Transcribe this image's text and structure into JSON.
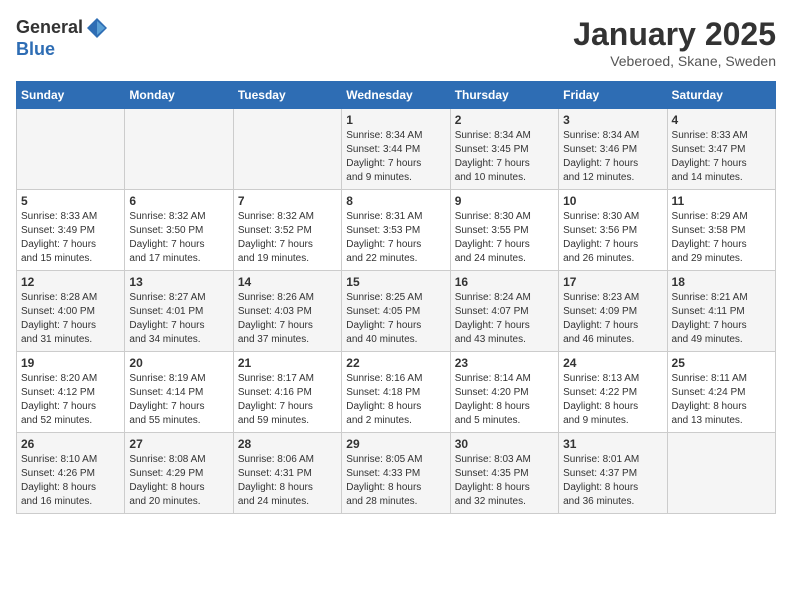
{
  "logo": {
    "general": "General",
    "blue": "Blue"
  },
  "title": "January 2025",
  "location": "Veberoed, Skane, Sweden",
  "days_of_week": [
    "Sunday",
    "Monday",
    "Tuesday",
    "Wednesday",
    "Thursday",
    "Friday",
    "Saturday"
  ],
  "weeks": [
    [
      {
        "day": "",
        "info": ""
      },
      {
        "day": "",
        "info": ""
      },
      {
        "day": "",
        "info": ""
      },
      {
        "day": "1",
        "info": "Sunrise: 8:34 AM\nSunset: 3:44 PM\nDaylight: 7 hours\nand 9 minutes."
      },
      {
        "day": "2",
        "info": "Sunrise: 8:34 AM\nSunset: 3:45 PM\nDaylight: 7 hours\nand 10 minutes."
      },
      {
        "day": "3",
        "info": "Sunrise: 8:34 AM\nSunset: 3:46 PM\nDaylight: 7 hours\nand 12 minutes."
      },
      {
        "day": "4",
        "info": "Sunrise: 8:33 AM\nSunset: 3:47 PM\nDaylight: 7 hours\nand 14 minutes."
      }
    ],
    [
      {
        "day": "5",
        "info": "Sunrise: 8:33 AM\nSunset: 3:49 PM\nDaylight: 7 hours\nand 15 minutes."
      },
      {
        "day": "6",
        "info": "Sunrise: 8:32 AM\nSunset: 3:50 PM\nDaylight: 7 hours\nand 17 minutes."
      },
      {
        "day": "7",
        "info": "Sunrise: 8:32 AM\nSunset: 3:52 PM\nDaylight: 7 hours\nand 19 minutes."
      },
      {
        "day": "8",
        "info": "Sunrise: 8:31 AM\nSunset: 3:53 PM\nDaylight: 7 hours\nand 22 minutes."
      },
      {
        "day": "9",
        "info": "Sunrise: 8:30 AM\nSunset: 3:55 PM\nDaylight: 7 hours\nand 24 minutes."
      },
      {
        "day": "10",
        "info": "Sunrise: 8:30 AM\nSunset: 3:56 PM\nDaylight: 7 hours\nand 26 minutes."
      },
      {
        "day": "11",
        "info": "Sunrise: 8:29 AM\nSunset: 3:58 PM\nDaylight: 7 hours\nand 29 minutes."
      }
    ],
    [
      {
        "day": "12",
        "info": "Sunrise: 8:28 AM\nSunset: 4:00 PM\nDaylight: 7 hours\nand 31 minutes."
      },
      {
        "day": "13",
        "info": "Sunrise: 8:27 AM\nSunset: 4:01 PM\nDaylight: 7 hours\nand 34 minutes."
      },
      {
        "day": "14",
        "info": "Sunrise: 8:26 AM\nSunset: 4:03 PM\nDaylight: 7 hours\nand 37 minutes."
      },
      {
        "day": "15",
        "info": "Sunrise: 8:25 AM\nSunset: 4:05 PM\nDaylight: 7 hours\nand 40 minutes."
      },
      {
        "day": "16",
        "info": "Sunrise: 8:24 AM\nSunset: 4:07 PM\nDaylight: 7 hours\nand 43 minutes."
      },
      {
        "day": "17",
        "info": "Sunrise: 8:23 AM\nSunset: 4:09 PM\nDaylight: 7 hours\nand 46 minutes."
      },
      {
        "day": "18",
        "info": "Sunrise: 8:21 AM\nSunset: 4:11 PM\nDaylight: 7 hours\nand 49 minutes."
      }
    ],
    [
      {
        "day": "19",
        "info": "Sunrise: 8:20 AM\nSunset: 4:12 PM\nDaylight: 7 hours\nand 52 minutes."
      },
      {
        "day": "20",
        "info": "Sunrise: 8:19 AM\nSunset: 4:14 PM\nDaylight: 7 hours\nand 55 minutes."
      },
      {
        "day": "21",
        "info": "Sunrise: 8:17 AM\nSunset: 4:16 PM\nDaylight: 7 hours\nand 59 minutes."
      },
      {
        "day": "22",
        "info": "Sunrise: 8:16 AM\nSunset: 4:18 PM\nDaylight: 8 hours\nand 2 minutes."
      },
      {
        "day": "23",
        "info": "Sunrise: 8:14 AM\nSunset: 4:20 PM\nDaylight: 8 hours\nand 5 minutes."
      },
      {
        "day": "24",
        "info": "Sunrise: 8:13 AM\nSunset: 4:22 PM\nDaylight: 8 hours\nand 9 minutes."
      },
      {
        "day": "25",
        "info": "Sunrise: 8:11 AM\nSunset: 4:24 PM\nDaylight: 8 hours\nand 13 minutes."
      }
    ],
    [
      {
        "day": "26",
        "info": "Sunrise: 8:10 AM\nSunset: 4:26 PM\nDaylight: 8 hours\nand 16 minutes."
      },
      {
        "day": "27",
        "info": "Sunrise: 8:08 AM\nSunset: 4:29 PM\nDaylight: 8 hours\nand 20 minutes."
      },
      {
        "day": "28",
        "info": "Sunrise: 8:06 AM\nSunset: 4:31 PM\nDaylight: 8 hours\nand 24 minutes."
      },
      {
        "day": "29",
        "info": "Sunrise: 8:05 AM\nSunset: 4:33 PM\nDaylight: 8 hours\nand 28 minutes."
      },
      {
        "day": "30",
        "info": "Sunrise: 8:03 AM\nSunset: 4:35 PM\nDaylight: 8 hours\nand 32 minutes."
      },
      {
        "day": "31",
        "info": "Sunrise: 8:01 AM\nSunset: 4:37 PM\nDaylight: 8 hours\nand 36 minutes."
      },
      {
        "day": "",
        "info": ""
      }
    ]
  ]
}
